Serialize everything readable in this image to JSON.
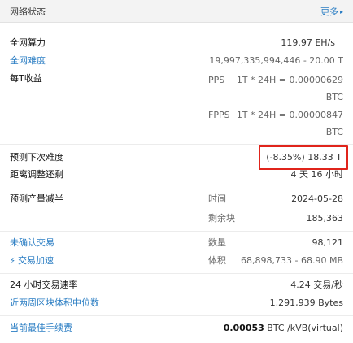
{
  "header": {
    "title": "网络状态",
    "more_label": "更多",
    "more_icon": "caret-right-icon"
  },
  "hashrate": {
    "label": "全网算力",
    "value": "119.97 EH/s"
  },
  "difficulty": {
    "label": "全网难度",
    "value": "19,997,335,994,446 - 20.00 T"
  },
  "per_t": {
    "label": "每T收益",
    "pps_label": "PPS",
    "pps_value": "1T * 24H = 0.00000629",
    "pps_unit": "BTC",
    "fpps_label": "FPPS",
    "fpps_value": "1T * 24H = 0.00000847",
    "fpps_unit": "BTC"
  },
  "next_difficulty": {
    "label": "预测下次难度",
    "value": "(-8.35%) 18.33 T"
  },
  "adjust_remaining": {
    "label": "距离调整还剩",
    "value": "4 天 16 小时"
  },
  "halving": {
    "label": "预测产量减半",
    "time_label": "时间",
    "time_value": "2024-05-28",
    "blocks_label": "剩余块",
    "blocks_value": "185,363"
  },
  "unconfirmed": {
    "label": "未确认交易",
    "accelerate_label": "交易加速",
    "accelerate_icon": "lightning-icon",
    "count_label": "数量",
    "count_value": "98,121",
    "volume_label": "体积",
    "volume_value": "68,898,733 - 68.90 MB"
  },
  "tx_rate": {
    "label": "24 小时交易速率",
    "value": "4.24 交易/秒"
  },
  "median_block": {
    "label": "近两周区块体积中位数",
    "value": "1,291,939 Bytes"
  },
  "best_fee": {
    "label": "当前最佳手续费",
    "value_bold": "0.00053",
    "value_rest": " BTC /kVB(virtual)"
  },
  "colors": {
    "link": "#2a7dc3",
    "highlight_border": "#e0241b",
    "header_bg": "#f3f3f3"
  }
}
